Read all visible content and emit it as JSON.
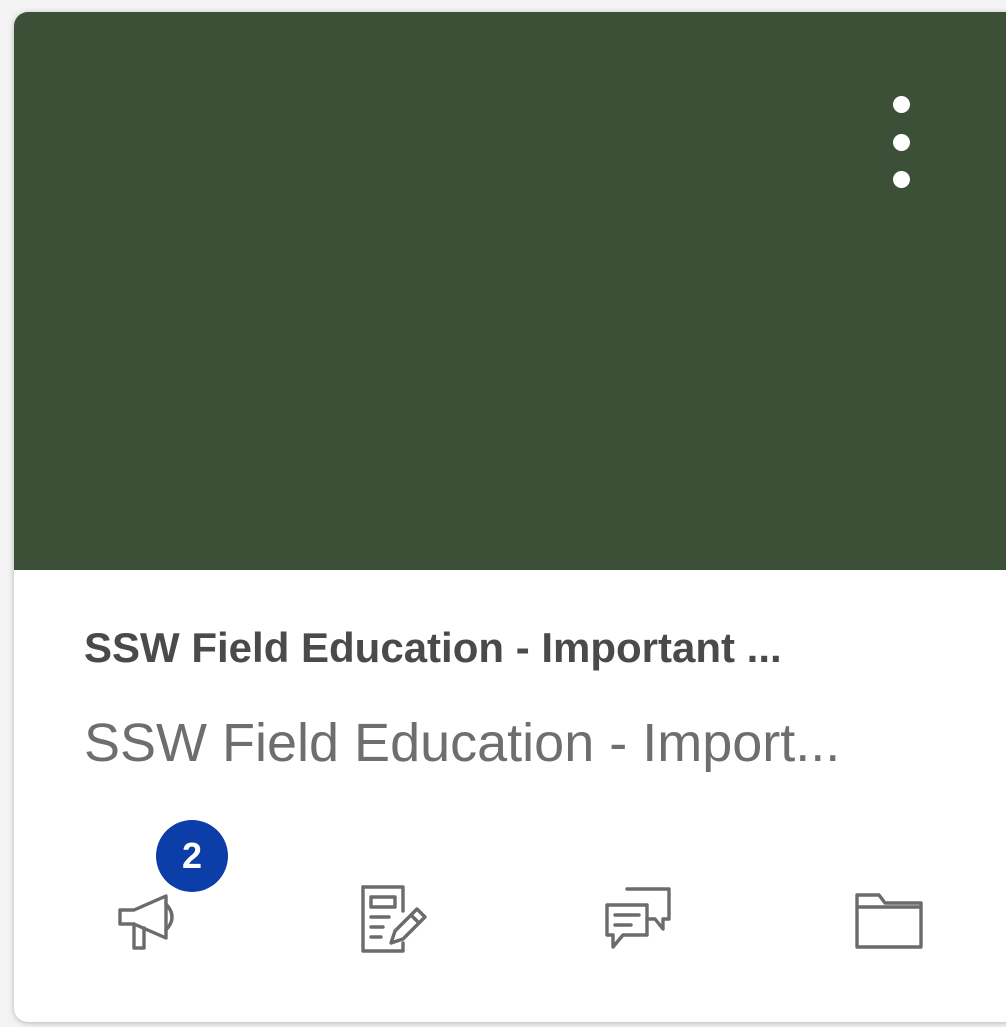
{
  "card": {
    "title": "SSW Field Education - Important ...",
    "subtitle": "SSW Field Education - Import...",
    "hero_color": "#3b5036",
    "options_icon": "kebab-menu-icon",
    "actions": [
      {
        "name": "announcements",
        "icon": "megaphone-icon",
        "badge": "2"
      },
      {
        "name": "assignments",
        "icon": "assignment-edit-icon"
      },
      {
        "name": "discussions",
        "icon": "discussion-icon"
      },
      {
        "name": "files",
        "icon": "folder-icon"
      }
    ]
  }
}
